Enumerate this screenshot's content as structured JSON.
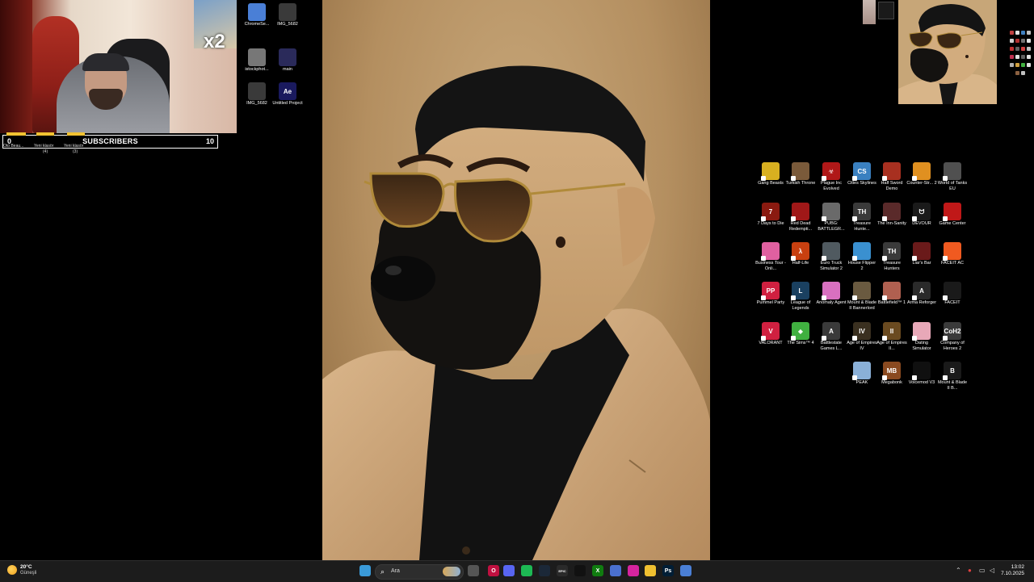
{
  "webcam": {
    "multiplier": "x2"
  },
  "subscribers": {
    "current": "0",
    "title": "SUBSCRIBERS",
    "goal": "10",
    "goal_labels": [
      {
        "name": "Oto Beau...",
        "count": ""
      },
      {
        "name": "Yeni klasör",
        "count": "(4)"
      },
      {
        "name": "Yeni klasör",
        "count": "(3)"
      }
    ]
  },
  "left_icons": [
    {
      "label": "ChromeSe...",
      "icon": "chrome-setup-icon",
      "color": "#4a7fd6"
    },
    {
      "label": "IMG_5682",
      "icon": "photo-thumbnail-icon",
      "color": "#3a3a3a"
    },
    {
      "label": "istockphot...",
      "icon": "image-file-icon",
      "color": "#777"
    },
    {
      "label": "main",
      "icon": "image-file-icon",
      "color": "#2a2a5a"
    },
    {
      "label": "IMG_5682",
      "icon": "photo-thumbnail-icon",
      "color": "#3a3a3a"
    },
    {
      "label": "Untitled Project",
      "icon": "after-effects-icon",
      "color": "#1a1a5e",
      "text": "Ae"
    }
  ],
  "game_icons": [
    {
      "label": "Gang Beasts",
      "icon": "gang-beasts-icon",
      "color": "#d8b020",
      "text": ""
    },
    {
      "label": "Turkish Throne",
      "icon": "turkish-throne-icon",
      "color": "#7a5a3a",
      "text": ""
    },
    {
      "label": "Plague Inc Evolved",
      "icon": "plague-inc-icon",
      "color": "#b01818",
      "text": "☣"
    },
    {
      "label": "Cities Skylines",
      "icon": "cities-skylines-icon",
      "color": "#3a80c0",
      "text": "CS"
    },
    {
      "label": "Half Sword Demo",
      "icon": "half-sword-icon",
      "color": "#a83020",
      "text": ""
    },
    {
      "label": "Counter-Str... 2",
      "icon": "counter-strike-icon",
      "color": "#e09020",
      "text": ""
    },
    {
      "label": "World of Tanks EU",
      "icon": "world-of-tanks-icon",
      "color": "#505050",
      "text": ""
    },
    {
      "label": "7 Days to Die",
      "icon": "seven-days-icon",
      "color": "#8a1a10",
      "text": "7"
    },
    {
      "label": "Red Dead Redempti...",
      "icon": "red-dead-icon",
      "color": "#a01818",
      "text": ""
    },
    {
      "label": "PUBG: BATTLEGR...",
      "icon": "pubg-icon",
      "color": "#6a6a6a",
      "text": ""
    },
    {
      "label": "Treasure Hunte...",
      "icon": "treasure-hunter-icon",
      "color": "#3a3a3a",
      "text": "TH"
    },
    {
      "label": "The Inn-Sanity",
      "icon": "inn-sanity-icon",
      "color": "#5a2a2a",
      "text": ""
    },
    {
      "label": "DEVOUR",
      "icon": "devour-icon",
      "color": "#1a1a1a",
      "text": "ᗢ"
    },
    {
      "label": "Game Center",
      "icon": "game-center-icon",
      "color": "#c01818",
      "text": ""
    },
    {
      "label": "Business Tour - Onli...",
      "icon": "business-tour-icon",
      "color": "#e060a0",
      "text": ""
    },
    {
      "label": "Half-Life",
      "icon": "half-life-icon",
      "color": "#c84010",
      "text": "λ"
    },
    {
      "label": "Euro Truck Simulator 2",
      "icon": "euro-truck-icon",
      "color": "#505a60",
      "text": ""
    },
    {
      "label": "House Flipper 2",
      "icon": "house-flipper-icon",
      "color": "#3a90d0",
      "text": ""
    },
    {
      "label": "Treasure Hunters",
      "icon": "treasure-hunters-icon",
      "color": "#3a3a3a",
      "text": "TH"
    },
    {
      "label": "Liar's Bar",
      "icon": "liars-bar-icon",
      "color": "#6a1a1a",
      "text": ""
    },
    {
      "label": "FACEIT AC",
      "icon": "faceit-ac-icon",
      "color": "#f05a20",
      "text": ""
    },
    {
      "label": "Pummel Party",
      "icon": "pummel-party-icon",
      "color": "#d02040",
      "text": "PP"
    },
    {
      "label": "League of Legends",
      "icon": "league-icon",
      "color": "#1a4060",
      "text": "L"
    },
    {
      "label": "Anomaly Agent",
      "icon": "anomaly-agent-icon",
      "color": "#d870c0",
      "text": ""
    },
    {
      "label": "Mount & Blade II Bannerlord",
      "icon": "bannerlord-icon",
      "color": "#6a5a40",
      "text": ""
    },
    {
      "label": "Battlefield™ 1",
      "icon": "battlefield-icon",
      "color": "#b06050",
      "text": ""
    },
    {
      "label": "Arma Reforger",
      "icon": "arma-reforger-icon",
      "color": "#2a2a2a",
      "text": "A"
    },
    {
      "label": "FACEIT",
      "icon": "faceit-icon",
      "color": "#1a1a1a",
      "text": ""
    },
    {
      "label": "VALORANT",
      "icon": "valorant-icon",
      "color": "#d02040",
      "text": "V"
    },
    {
      "label": "The Sims™ 4",
      "icon": "sims-icon",
      "color": "#40b040",
      "text": "◆"
    },
    {
      "label": "Battlestate Games L...",
      "icon": "battlestate-icon",
      "color": "#3a3a3a",
      "text": "A"
    },
    {
      "label": "Age of Empires IV",
      "icon": "age-of-empires-4-icon",
      "color": "#3a3020",
      "text": "IV"
    },
    {
      "label": "Age of Empires II...",
      "icon": "age-of-empires-2-icon",
      "color": "#6a4a20",
      "text": "II"
    },
    {
      "label": "Dating Simulator",
      "icon": "dating-simulator-icon",
      "color": "#e8a8b8",
      "text": ""
    },
    {
      "label": "Company of Heroes 2",
      "icon": "company-of-heroes-icon",
      "color": "#3a3a3a",
      "text": "CoH2"
    },
    {
      "label": "PEAK",
      "icon": "peak-icon",
      "color": "#8ab0d8",
      "text": ""
    },
    {
      "label": "Megabonk",
      "icon": "megabonk-icon",
      "color": "#8a4a20",
      "text": "MB"
    },
    {
      "label": "Voicemod V3",
      "icon": "voicemod-icon",
      "color": "#101010",
      "text": ""
    },
    {
      "label": "Mount & Blade II B...",
      "icon": "mount-blade-icon",
      "color": "#1a1a1a",
      "text": "B"
    }
  ],
  "taskbar": {
    "weather_temp": "20°C",
    "weather_condition": "Güneşli",
    "search_placeholder": "Ara",
    "time": "13:02",
    "date": "7.10.2025",
    "apps": [
      {
        "icon": "start-icon",
        "color": "#3a9ad8",
        "text": ""
      },
      {
        "icon": "task-view-icon",
        "color": "#555",
        "text": ""
      },
      {
        "icon": "opera-icon",
        "color": "#c01040",
        "text": "O"
      },
      {
        "icon": "discord-icon",
        "color": "#5865f2",
        "text": ""
      },
      {
        "icon": "spotify-icon",
        "color": "#1db954",
        "text": ""
      },
      {
        "icon": "steam-icon",
        "color": "#1b2838",
        "text": ""
      },
      {
        "icon": "epic-games-icon",
        "color": "#2a2a2a",
        "text": "EPIC"
      },
      {
        "icon": "capcut-icon",
        "color": "#111",
        "text": ""
      },
      {
        "icon": "xbox-icon",
        "color": "#107c10",
        "text": "X"
      },
      {
        "icon": "copilot-icon",
        "color": "#4a70d0",
        "text": ""
      },
      {
        "icon": "instagram-icon",
        "color": "#d6249f",
        "text": ""
      },
      {
        "icon": "file-explorer-icon",
        "color": "#f0c030",
        "text": ""
      },
      {
        "icon": "photoshop-icon",
        "color": "#001e36",
        "text": "Ps"
      },
      {
        "icon": "chrome-icon",
        "color": "#4a7fd6",
        "text": ""
      }
    ]
  }
}
